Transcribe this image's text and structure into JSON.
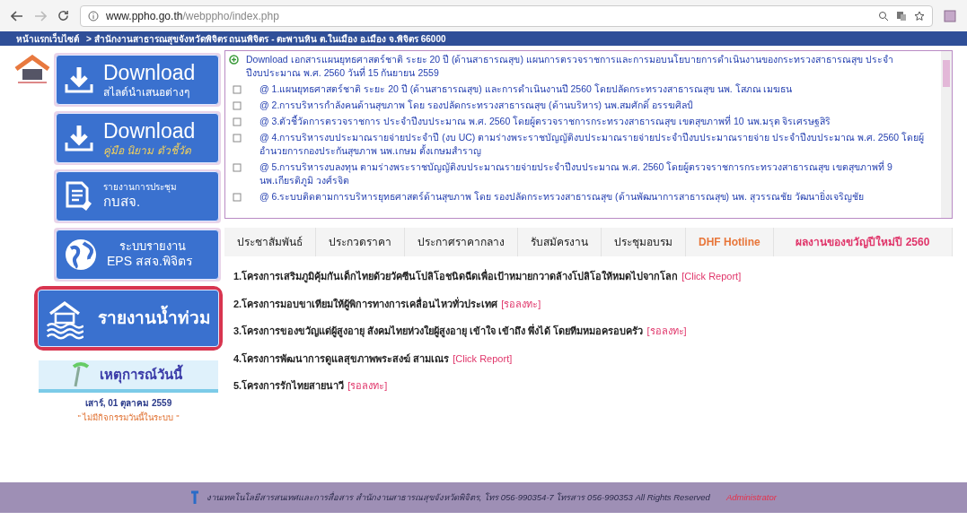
{
  "browser": {
    "url_host": "www.ppho.go.th",
    "url_path": "/webppho/index.php"
  },
  "breadcrumb": [
    "หน้าแรกเว็บไซต์",
    "> สำนักงานสาธารณสุขจังหวัดพิจิตร ถนนพิจิตร - ตะพานหิน ต.ในเมือง อ.เมือง จ.พิจิตร 66000"
  ],
  "sidebar": {
    "buttons": [
      {
        "kind": "download",
        "title": "Download",
        "subtitle": "สไลด์นำเสนอต่างๆ",
        "highlighted": false
      },
      {
        "kind": "download",
        "title": "Download",
        "subtitle": "คู่มือ นิยาม ตัวชี้วัด",
        "highlighted": false
      },
      {
        "kind": "document",
        "title": "รายงานการประชุม",
        "subtitle": "กบสจ.",
        "highlighted": false
      },
      {
        "kind": "globe",
        "title": "ระบบรายงาน",
        "subtitle": "EPS สสจ.พิจิตร",
        "highlighted": false
      },
      {
        "kind": "flood",
        "title": "รายงานน้ำท่วม",
        "highlighted": true
      }
    ],
    "events": {
      "title": "เหตุการณ์วันนี้",
      "date": "เสาร์, 01 ตุลาคม 2559",
      "message": "\" ไม่มีกิจกรรมวันนี้ในระบบ \""
    }
  },
  "announcements": [
    {
      "kind": "header",
      "text": "Download เอกสารแผนยุทธศาสตร์ชาติ ระยะ 20 ปี (ด้านสาธารณสุข) แผนการตรวจราชการและการมอบนโยบายการดำเนินงานของกระทรวงสาธารณสุข ประจำปีงบประมาณ พ.ศ. 2560 วันที่ 15 กันยายน 2559"
    },
    {
      "kind": "item",
      "text": "@ 1.แผนยุทธศาสตร์ชาติ ระยะ 20 ปี (ด้านสาธารณสุข) และการดำเนินงานปี 2560 โดยปลัดกระทรวงสาธารณสุข นพ. โสภณ เมฆธน"
    },
    {
      "kind": "item",
      "text": "@ 2.การบริหารกำลังคนด้านสุขภาพ โดย รองปลัดกระทรวงสาธารณสุข (ด้านบริหาร) นพ.สมศักดิ์ อรรฆศิลป์"
    },
    {
      "kind": "item",
      "text": "@ 3.ตัวชี้วัดการตรวจราชการ ประจำปีงบประมาณ พ.ศ. 2560 โดยผู้ตรวจราชการกระทรวงสาธารณสุข เขตสุขภาพที่ 10 นพ.มรุต จิรเศรษฐสิริ"
    },
    {
      "kind": "item",
      "text": "@ 4.การบริหารงบประมาณรายจ่ายประจำปี (งบ UC) ตามร่างพระราชบัญญัติงบประมาณรายจ่ายประจำปีงบประมาณรายจ่าย ประจำปีงบประมาณ พ.ศ. 2560 โดยผู้อำนวยการกองประกันสุขภาพ นพ.เกษม ตั้งเกษมสำราญ"
    },
    {
      "kind": "item",
      "text": "@ 5.การบริหารงบลงทุน ตามร่างพระราชบัญญัติงบประมาณรายจ่ายประจำปีงบประมาณ พ.ศ. 2560 โดยผู้ตรวจราชการกระทรวงสาธารณสุข เขตสุขภาพที่ 9 นพ.เกียรติภูมิ วงศ์รจิต"
    },
    {
      "kind": "item",
      "text": "@ 6.ระบบติดตามการบริหารยุทธศาสตร์ด้านสุขภาพ โดย รองปลัดกระทรวงสาธารณสุข (ด้านพัฒนาการสาธารณสุข) นพ. สุวรรณชัย วัฒนายิ่งเจริญชัย"
    }
  ],
  "tabs": [
    {
      "label": "ประชาสัมพันธ์",
      "color": "#222222"
    },
    {
      "label": "ประกวดราคา",
      "color": "#222222"
    },
    {
      "label": "ประกาศราคากลาง",
      "color": "#222222"
    },
    {
      "label": "รับสมัครงาน",
      "color": "#222222"
    },
    {
      "label": "ประชุมอบรม",
      "color": "#222222"
    },
    {
      "label": "DHF Hotline",
      "color": "#e8763a"
    },
    {
      "label": "ผลงานของขวัญปีใหม่ปี 2560",
      "color": "#e0356a"
    }
  ],
  "projects": [
    {
      "title": "1.โครงการเสริมภูมิคุ้มกันเด็กไทยด้วยวัคซีนโปลิโอชนิดฉีดเพื่อเป้าหมายกวาดล้างโปลิโอให้หมดไปจากโลก",
      "link": "[Click Report]"
    },
    {
      "title": "2.โครงการมอบขาเทียมให้ผู้พิการทางการเคลื่อนไหวทั่วประเทศ",
      "link": "[รอลงทะ]"
    },
    {
      "title": "3.โครงการของขวัญแด่ผู้สูงอายุ สังคมไทยห่วงใยผู้สูงอายุ เข้าใจ เข้าถึง พึ่งได้ โดยทีมหมอครอบครัว",
      "link": "[รอลงทะ]"
    },
    {
      "title": "4.โครงการพัฒนาการดูแลสุขภาพพระสงฆ์ สามเณร",
      "link": "[Click Report]"
    },
    {
      "title": "5.โครงการรักไทยสายนาวี",
      "link": "[รอลงทะ]"
    }
  ],
  "footer": {
    "text": "งานเทคโนโลยีสารสนเทศและการสื่อสาร สำนักงานสาธารณสุขจังหวัดพิจิตร, โทร 056-990354-7 โทรสาร 056-990353 All Rights Reserved",
    "admin": "Administrator"
  }
}
